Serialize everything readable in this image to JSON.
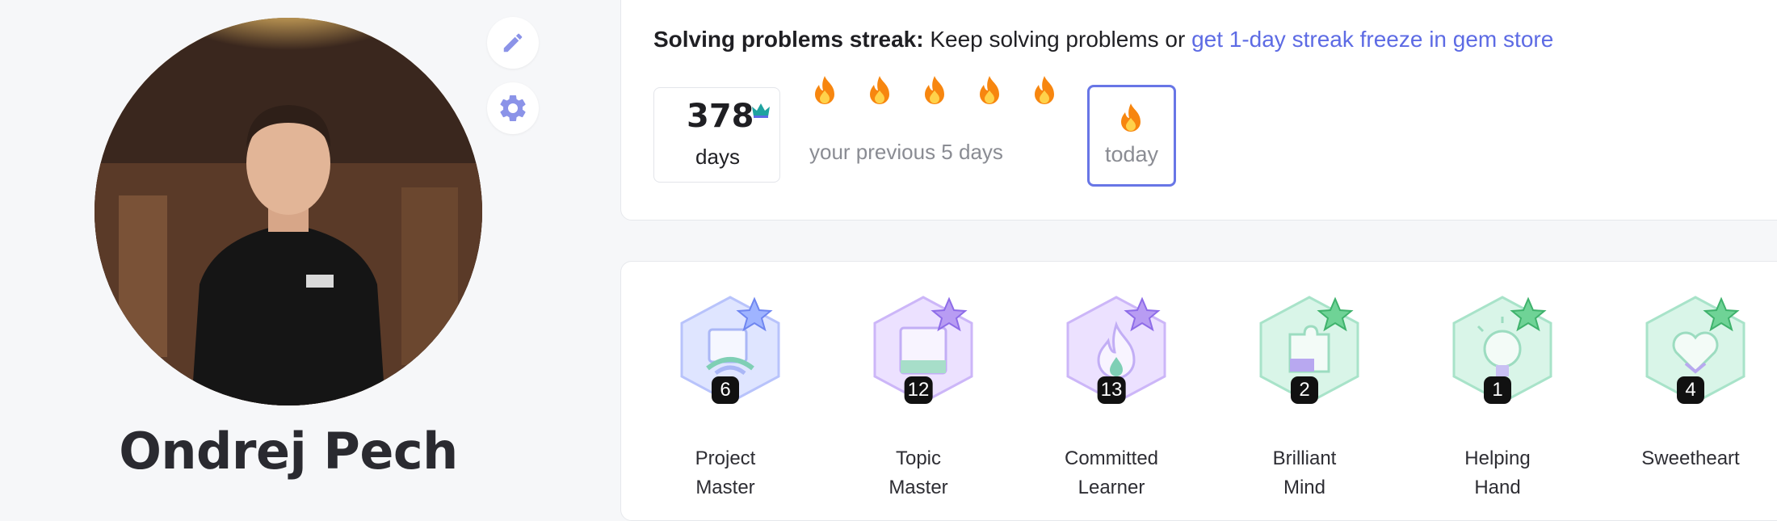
{
  "profile": {
    "name": "Ondrej Pech"
  },
  "streak": {
    "title_bold": "Solving problems streak:",
    "title_text": " Keep solving problems or ",
    "title_link": "get 1-day streak freeze in gem store",
    "days_count": "378",
    "days_label": "days",
    "previous_label": "your previous 5 days",
    "today_label": "today",
    "link_color": "#5d6be4",
    "today_border_color": "#6876e6"
  },
  "badges": [
    {
      "count": "6",
      "line1": "Project",
      "line2": "Master",
      "theme": "blue"
    },
    {
      "count": "12",
      "line1": "Topic",
      "line2": "Master",
      "theme": "purple"
    },
    {
      "count": "13",
      "line1": "Committed",
      "line2": "Learner",
      "theme": "purple"
    },
    {
      "count": "2",
      "line1": "Brilliant",
      "line2": "Mind",
      "theme": "green"
    },
    {
      "count": "1",
      "line1": "Helping",
      "line2": "Hand",
      "theme": "green"
    },
    {
      "count": "4",
      "line1": "Sweetheart",
      "line2": "",
      "theme": "green"
    }
  ],
  "icons": {
    "edit": "pencil-icon",
    "settings": "gear-icon",
    "crown": "crown-icon",
    "flame": "flame-icon"
  }
}
